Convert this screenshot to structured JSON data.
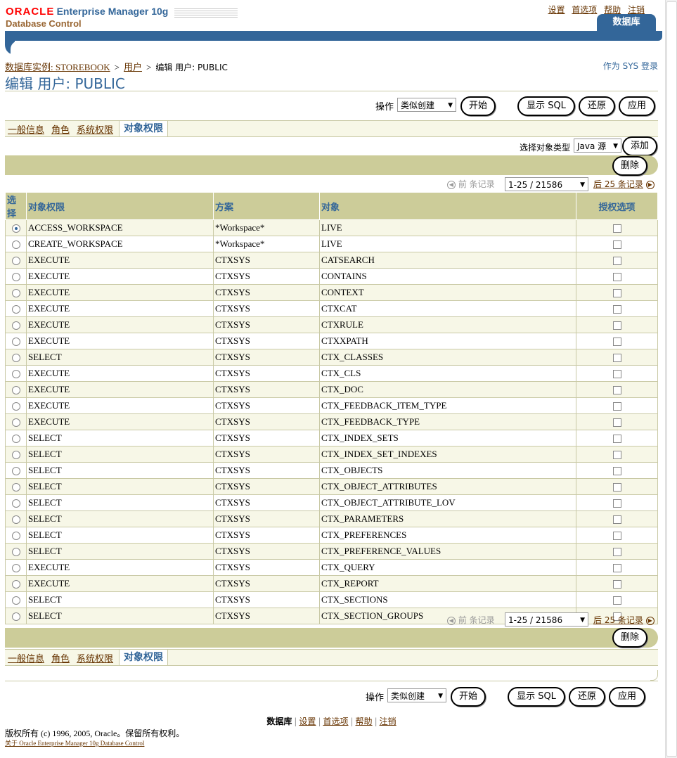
{
  "header": {
    "oracle": "ORACLE",
    "product": "Enterprise Manager 10g",
    "subtitle": "Database Control",
    "global_links": [
      "设置",
      "首选项",
      "帮助",
      "注销"
    ],
    "tab": "数据库"
  },
  "breadcrumb": {
    "instance": "数据库实例: STOREBOOK",
    "users": "用户",
    "current": "编辑  用户: PUBLIC",
    "sep": ">"
  },
  "login_as": "作为  SYS 登录",
  "page_title": "编辑  用户: PUBLIC",
  "actions": {
    "label": "操作",
    "selected": "类似创建",
    "go": "开始",
    "show_sql": "显示 SQL",
    "revert": "还原",
    "apply": "应用"
  },
  "subtabs": {
    "general": "一般信息",
    "roles": "角色",
    "system_privs": "系统权限",
    "object_privs": "对象权限"
  },
  "object_type": {
    "label": "选择对象类型",
    "selected": "Java 源",
    "add": "添加"
  },
  "delete": "删除",
  "nav": {
    "prev": "前  条记录",
    "range": "1-25 / 21586",
    "next": "后 25 条记录"
  },
  "table": {
    "headers": [
      "选择",
      "对象权限",
      "方案",
      "对象",
      "授权选项"
    ],
    "rows": [
      [
        "ACCESS_WORKSPACE",
        "*Workspace*",
        "LIVE"
      ],
      [
        "CREATE_WORKSPACE",
        "*Workspace*",
        "LIVE"
      ],
      [
        "EXECUTE",
        "CTXSYS",
        "CATSEARCH"
      ],
      [
        "EXECUTE",
        "CTXSYS",
        "CONTAINS"
      ],
      [
        "EXECUTE",
        "CTXSYS",
        "CONTEXT"
      ],
      [
        "EXECUTE",
        "CTXSYS",
        "CTXCAT"
      ],
      [
        "EXECUTE",
        "CTXSYS",
        "CTXRULE"
      ],
      [
        "EXECUTE",
        "CTXSYS",
        "CTXXPATH"
      ],
      [
        "SELECT",
        "CTXSYS",
        "CTX_CLASSES"
      ],
      [
        "EXECUTE",
        "CTXSYS",
        "CTX_CLS"
      ],
      [
        "EXECUTE",
        "CTXSYS",
        "CTX_DOC"
      ],
      [
        "EXECUTE",
        "CTXSYS",
        "CTX_FEEDBACK_ITEM_TYPE"
      ],
      [
        "EXECUTE",
        "CTXSYS",
        "CTX_FEEDBACK_TYPE"
      ],
      [
        "SELECT",
        "CTXSYS",
        "CTX_INDEX_SETS"
      ],
      [
        "SELECT",
        "CTXSYS",
        "CTX_INDEX_SET_INDEXES"
      ],
      [
        "SELECT",
        "CTXSYS",
        "CTX_OBJECTS"
      ],
      [
        "SELECT",
        "CTXSYS",
        "CTX_OBJECT_ATTRIBUTES"
      ],
      [
        "SELECT",
        "CTXSYS",
        "CTX_OBJECT_ATTRIBUTE_LOV"
      ],
      [
        "SELECT",
        "CTXSYS",
        "CTX_PARAMETERS"
      ],
      [
        "SELECT",
        "CTXSYS",
        "CTX_PREFERENCES"
      ],
      [
        "SELECT",
        "CTXSYS",
        "CTX_PREFERENCE_VALUES"
      ],
      [
        "EXECUTE",
        "CTXSYS",
        "CTX_QUERY"
      ],
      [
        "EXECUTE",
        "CTXSYS",
        "CTX_REPORT"
      ],
      [
        "SELECT",
        "CTXSYS",
        "CTX_SECTIONS"
      ],
      [
        "SELECT",
        "CTXSYS",
        "CTX_SECTION_GROUPS"
      ]
    ]
  },
  "footer": {
    "current": "数据库",
    "links": [
      "设置",
      "首选项",
      "帮助",
      "注销"
    ],
    "copyright": "版权所有  (c) 1996, 2005, Oracle。保留所有权利。",
    "about": "关于  Oracle Enterprise Manager 10g Database Control"
  },
  "colors": {
    "accent": "#336699",
    "band": "#cccc99",
    "row_alt": "#f7f7e7",
    "link": "#663300"
  }
}
